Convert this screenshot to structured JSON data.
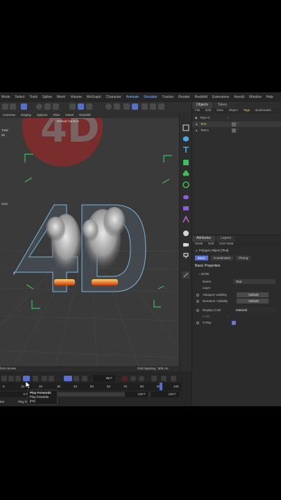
{
  "menu": [
    "Mode",
    "Select",
    "Tools",
    "Spline",
    "Mesh",
    "Volume",
    "MoGraph",
    "Character",
    "Animate",
    "Simulate",
    "Tracker",
    "Render",
    "Redshift",
    "Extensions",
    "Arnold",
    "Window",
    "Help"
  ],
  "viewport_header": [
    "Cameras",
    "Display",
    "Options",
    "Filter",
    "Panel",
    "Redshift"
  ],
  "viewport_camera": "Default Camera",
  "viewport_left_labels": [
    "Total",
    "96"
  ],
  "viewport_side_label": "ction",
  "viewport_footer": {
    "left": "form Scene",
    "right": "Grid Spacing : 500 cm"
  },
  "objects_panel": {
    "tabs": [
      "Objects",
      "Takes"
    ],
    "menu": [
      "File",
      "Edit",
      "View",
      "Object",
      "Tags",
      "Bookmarks"
    ],
    "items": [
      {
        "name": "Pyro C"
      },
      {
        "name": "Text"
      },
      {
        "name": "Text.1"
      }
    ]
  },
  "attributes_panel": {
    "tabs": [
      "Attributes",
      "Layers"
    ],
    "menu": [
      "Mode",
      "Edit",
      "User Data"
    ],
    "object_title": "Polygon Object [Text]",
    "subtabs": [
      "Basic",
      "Coordinates",
      "Phong"
    ],
    "section": "Basic Properties",
    "icon_label": "ICON",
    "rows": [
      {
        "label": "Name",
        "value": "Text"
      },
      {
        "label": "Layer",
        "value": ""
      },
      {
        "label": "Viewport Visibility",
        "value": "Default"
      },
      {
        "label": "Renderer Visibility",
        "value": "Default"
      },
      {
        "label": "Display Color",
        "value": "Material"
      },
      {
        "label": "Color",
        "value": ""
      },
      {
        "label": "X-Ray",
        "value": ""
      }
    ]
  },
  "timeline": {
    "current_frame": "88 F",
    "ruler": [
      "0",
      "10",
      "20",
      "30",
      "40",
      "50",
      "60",
      "70",
      "80",
      "90",
      "100"
    ],
    "start_field": "0 F",
    "end_field": "100 F",
    "end_field2": "100 F",
    "bottom_left": "tter",
    "bottom_mid": "Play fc"
  },
  "tooltip": {
    "title": "Play Forwards",
    "line1": "Play forwards",
    "line2": "[F8]"
  },
  "colors": {
    "accent": "#5a6fd0",
    "selected_text": "#f5c84a",
    "frame_marker": "#3fbf5a",
    "watermark": "#c81e1e"
  }
}
